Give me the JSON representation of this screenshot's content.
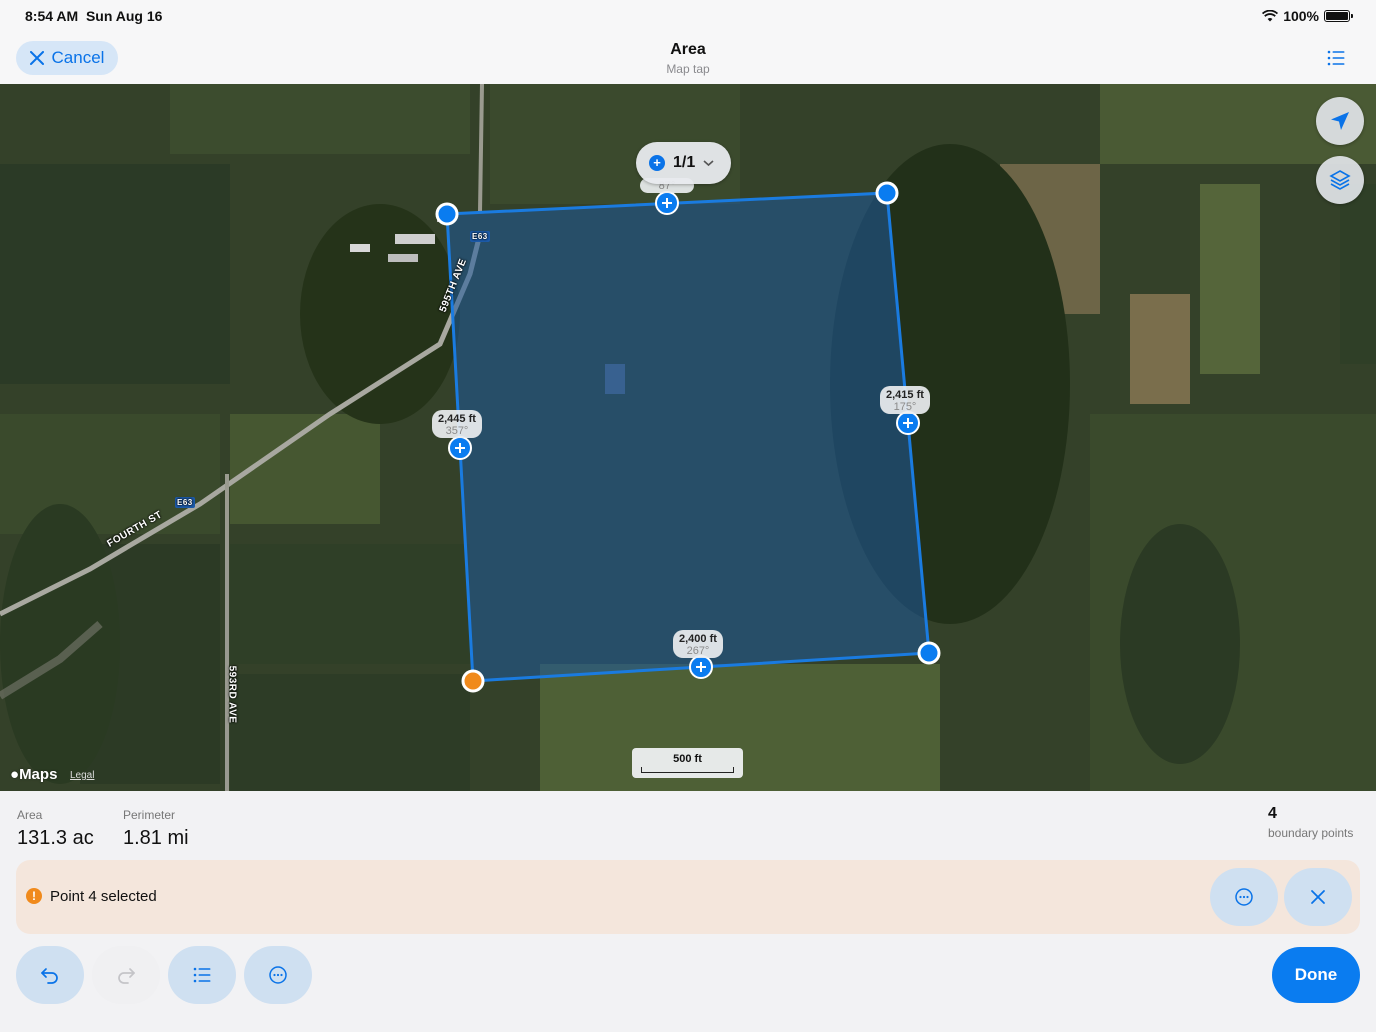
{
  "status_bar": {
    "time": "8:54 AM",
    "date": "Sun Aug 16",
    "battery": "100%"
  },
  "nav": {
    "cancel_label": "Cancel",
    "title": "Area",
    "subtitle": "Map tap"
  },
  "map": {
    "segment": {
      "label": "1/1"
    },
    "edge_labels": [
      {
        "distance": "",
        "bearing": "87°"
      },
      {
        "distance": "2,445 ft",
        "bearing": "357°"
      },
      {
        "distance": "2,415 ft",
        "bearing": "175°"
      },
      {
        "distance": "2,400 ft",
        "bearing": "267°"
      }
    ],
    "scale": "500 ft",
    "attribution": "Maps",
    "legal": "Legal",
    "roads": [
      "595TH AVE",
      "FOURTH ST",
      "593RD AVE"
    ],
    "shields": [
      "E63",
      "E63"
    ]
  },
  "panel": {
    "area_label": "Area",
    "area_value": "131.3 ac",
    "perimeter_label": "Perimeter",
    "perimeter_value": "1.81 mi",
    "points_count": "4",
    "points_label": "boundary points",
    "selection_text": "Point 4 selected",
    "done_label": "Done"
  },
  "colors": {
    "accent": "#0a7cf0",
    "selected_point": "#f08a1c",
    "polygon_fill": "#1e5a9c"
  }
}
